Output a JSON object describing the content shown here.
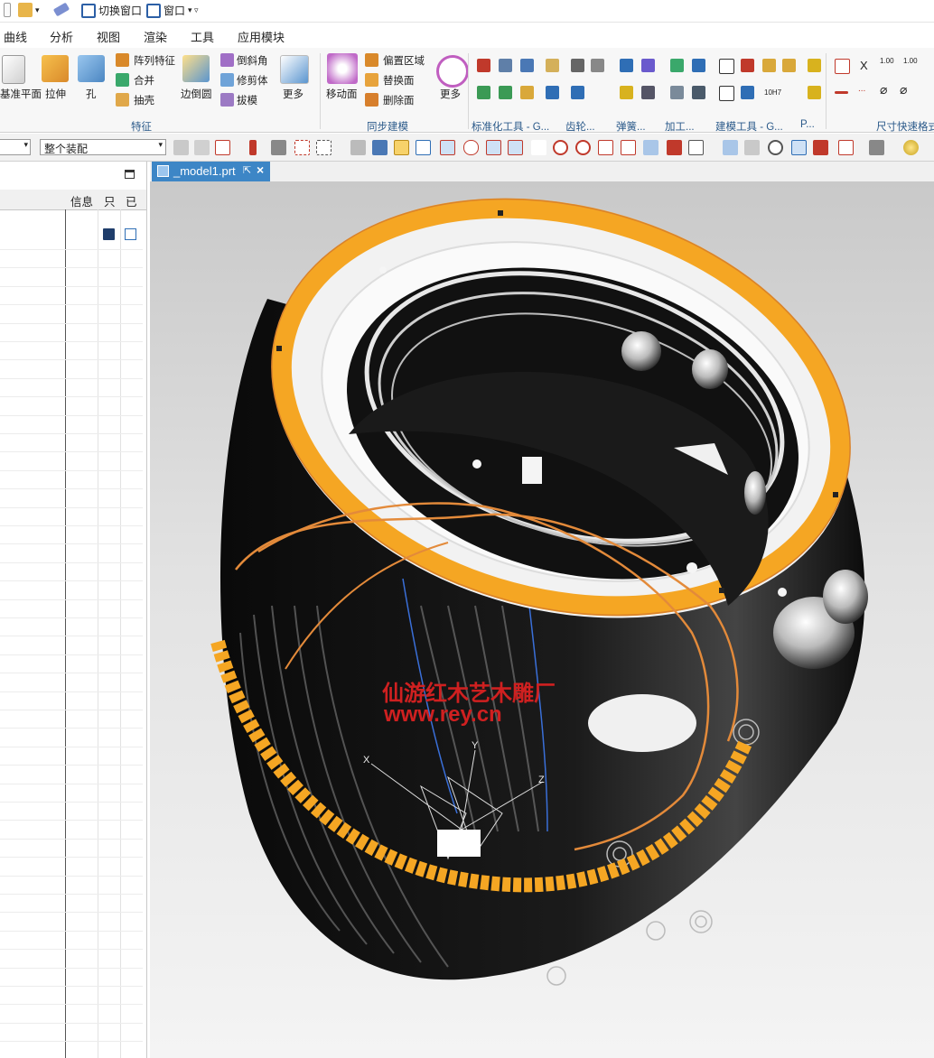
{
  "quick_access": {
    "switch_window": "切换窗口",
    "window": "窗口"
  },
  "menu": {
    "tabs": [
      "曲线",
      "分析",
      "视图",
      "渲染",
      "工具",
      "应用模块"
    ]
  },
  "ribbon": {
    "datum_plane": "基准平面",
    "extrude": "拉伸",
    "hole": "孔",
    "pattern_feature": "阵列特征",
    "unite": "合并",
    "shell": "抽壳",
    "edge_blend": "边倒圆",
    "chamfer": "倒斜角",
    "trim_body": "修剪体",
    "draft": "拔模",
    "more_1": "更多",
    "feature_group": "特征",
    "move_face": "移动面",
    "offset_region": "偏置区域",
    "replace_face": "替换面",
    "delete_face": "删除面",
    "more_2": "更多",
    "sync_group": "同步建模",
    "std_tools_group": "标准化工具 - G...",
    "gear_group": "齿轮...",
    "spring_group": "弹簧...",
    "machining_group": "加工...",
    "modeling_tools_group": "建模工具 - G...",
    "p_group": "P...",
    "quick_dim_group": "尺寸快速格式",
    "dim_label_1": "1.00",
    "dim_label_2": "1.00",
    "tol_label": "10H7"
  },
  "selection_bar": {
    "scope_value": "整个装配"
  },
  "navigator": {
    "col_info": "信息",
    "col_readonly": "只",
    "col_modified": "已"
  },
  "document": {
    "tab_label": "_model1.prt"
  },
  "viewport": {
    "watermark_line1": "仙游红木艺木雕厂",
    "watermark_line2": "www.rey.cn",
    "triad_x": "X",
    "triad_y": "Y",
    "triad_z": "Z"
  },
  "colors": {
    "accent_blue": "#3d86c6",
    "highlight_orange": "#f5a623",
    "watermark_red": "#cf2020"
  }
}
